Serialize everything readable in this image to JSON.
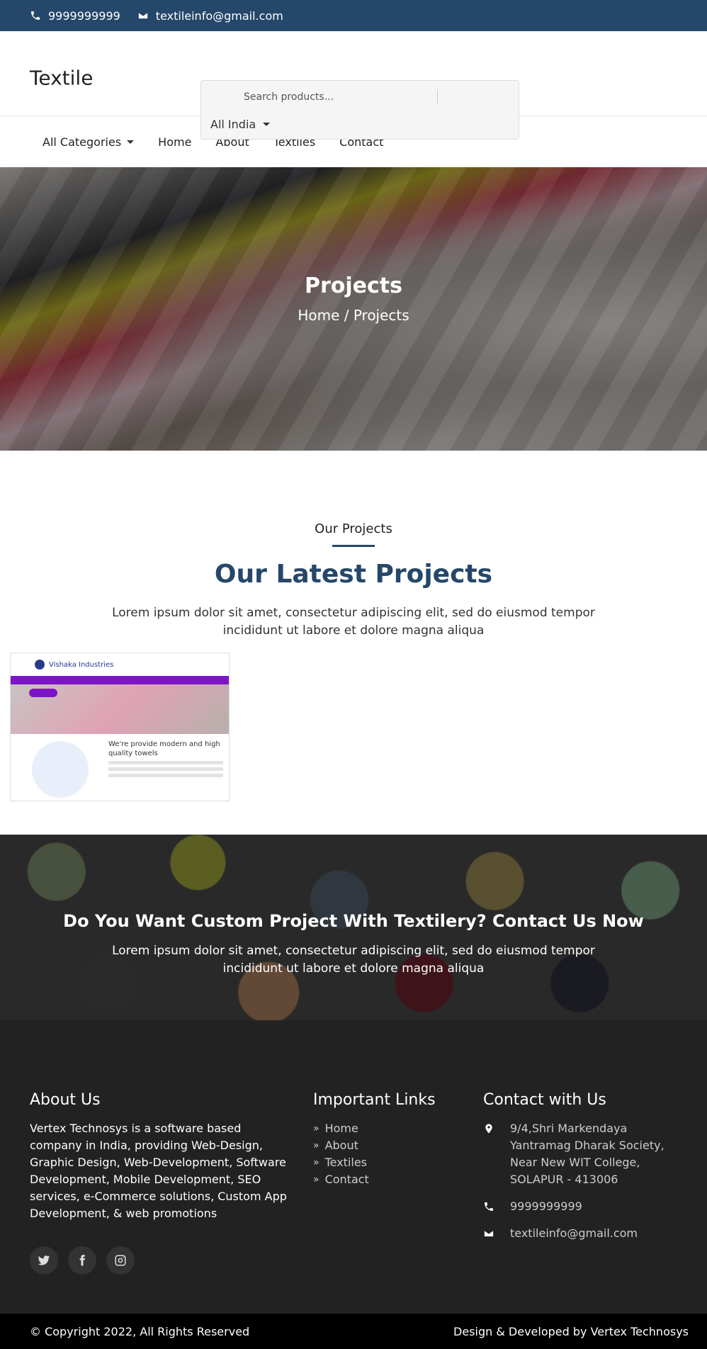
{
  "topbar": {
    "phone": "9999999999",
    "email": "textileinfo@gmail.com",
    "bg_color": "#25476a"
  },
  "header": {
    "logo": "Textile",
    "search_placeholder": "Search products...",
    "location": "All India"
  },
  "nav": {
    "items": [
      "All Categories",
      "Home",
      "About",
      "Textiles",
      "Contact"
    ]
  },
  "hero": {
    "title": "Projects",
    "breadcrumb": "Home / Projects"
  },
  "projects": {
    "subtitle": "Our Projects",
    "title": "Our Latest Projects",
    "description": "Lorem ipsum dolor sit amet, consectetur adipiscing elit, sed do eiusmod tempor incididunt ut labore et dolore magna aliqua",
    "thumbnail": {
      "brand": "Vishaka Industries",
      "tagline": "We're provide modern and high quality towels"
    }
  },
  "cta": {
    "title": "Do You Want Custom Project With Textilery? Contact Us Now",
    "description": "Lorem ipsum dolor sit amet, consectetur adipiscing elit, sed do eiusmod tempor incididunt ut labore et dolore magna aliqua"
  },
  "footer": {
    "about_title": "About Us",
    "about_text": "Vertex Technosys is a software based company in India, providing Web-Design, Graphic Design, Web-Development, Software Development, Mobile Development, SEO services, e-Commerce solutions, Custom App Development, & web promotions",
    "socials": [
      "twitter-icon",
      "facebook-icon",
      "instagram-icon"
    ],
    "links_title": "Important Links",
    "links": [
      "Home",
      "About",
      "Textiles",
      "Contact"
    ],
    "contact_title": "Contact with Us",
    "address": "9/4,Shri Markendaya Yantramag Dharak Society, Near New WIT College, SOLAPUR - 413006",
    "phone": "9999999999",
    "email": "textileinfo@gmail.com",
    "copyright": "© Copyright 2022, All Rights Reserved",
    "credit": "Design & Developed by Vertex Technosys"
  }
}
